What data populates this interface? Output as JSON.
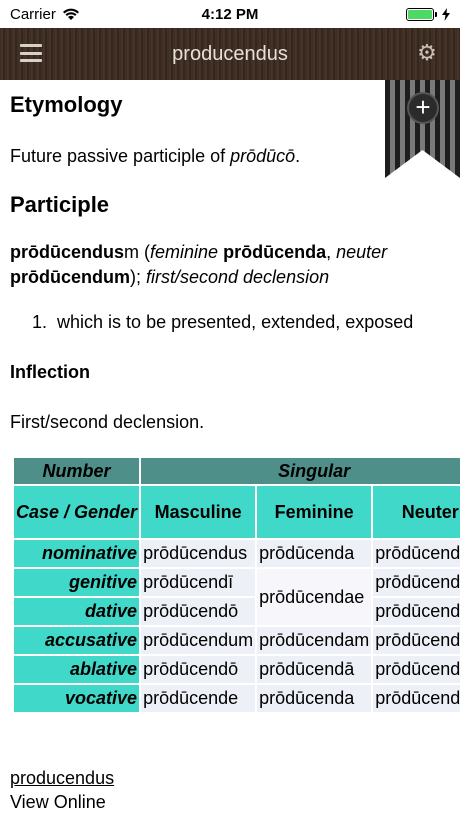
{
  "status": {
    "carrier": "Carrier",
    "time": "4:12 PM"
  },
  "nav": {
    "title": "producendus"
  },
  "sections": {
    "etymology_heading": "Etymology",
    "etymology_text_prefix": "Future passive participle of ",
    "etymology_text_word": "prōdūcō",
    "etymology_text_suffix": ".",
    "participle_heading": "Participle",
    "headword": "prōdūcendus",
    "gender": "m",
    "feminine_label": "feminine",
    "feminine_form": "prōdūcenda",
    "neuter_label": "neuter",
    "neuter_form": "prōdūcendum",
    "declension_note": "first/second declension",
    "sense_number": "1.",
    "sense_text": "which is to be presented, extended, exposed",
    "inflection_heading": "Inflection",
    "inflection_text": "First/second declension."
  },
  "table": {
    "number_label": "Number",
    "singular_label": "Singular",
    "case_gender_label": "Case / Gender",
    "columns": [
      "Masculine",
      "Feminine",
      "Neuter"
    ],
    "rows": [
      {
        "case": "nominative",
        "m": "prōdūcendus",
        "f": "prōdūcenda",
        "n": "prōdūcendum"
      },
      {
        "case": "genitive",
        "m": "prōdūcendī",
        "f": "prōdūcendae",
        "n": "prōdūcendī"
      },
      {
        "case": "dative",
        "m": "prōdūcendō",
        "n": "prōdūcendō"
      },
      {
        "case": "accusative",
        "m": "prōdūcendum",
        "f": "prōdūcendam",
        "n": "prōdūcendum"
      },
      {
        "case": "ablative",
        "m": "prōdūcendō",
        "f": "prōdūcendā",
        "n": "prōdūcendō"
      },
      {
        "case": "vocative",
        "m": "prōdūcende",
        "f": "prōdūcenda",
        "n": "prōdūcendum"
      }
    ]
  },
  "footer": {
    "link_text": "producendus",
    "view_online": "View Online"
  },
  "icons": {
    "menu": "hamburger-icon",
    "settings": "gear-icon",
    "bookmark": "bookmark-ribbon-icon",
    "add": "plus-icon",
    "wifi": "wifi-icon",
    "battery": "battery-icon",
    "charging": "bolt-icon"
  },
  "colors": {
    "header_dark": "#4f8f8a",
    "header_cyan": "#40d8c8",
    "cell_bg": "#eef0f8",
    "battery": "#4cd964"
  }
}
